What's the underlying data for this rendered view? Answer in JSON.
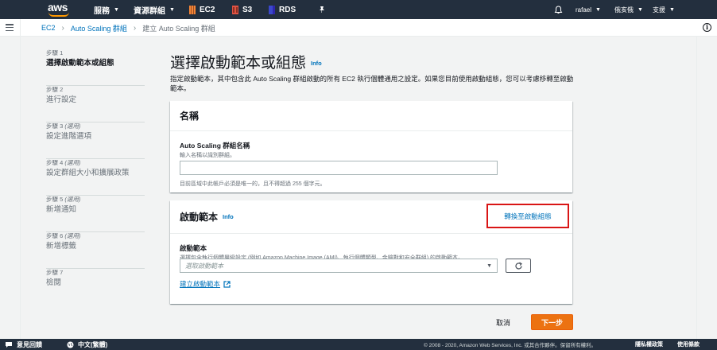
{
  "topnav": {
    "logo": "aws",
    "services": "服務",
    "resource_groups": "資源群組",
    "ec2": "EC2",
    "s3": "S3",
    "rds": "RDS",
    "user": "rafael",
    "region": "俄亥俄",
    "support": "支援",
    "colors": {
      "ec2": "#f58536",
      "s3": "#e05243",
      "rds": "#3b48cc",
      "bg": "#232f3e"
    }
  },
  "breadcrumb": {
    "items": [
      "EC2",
      "Auto Scaling 群組",
      "建立 Auto Scaling 群組"
    ]
  },
  "steps": [
    {
      "num": "步驟 1",
      "optional": "",
      "title": "選擇啟動範本或組態",
      "active": true
    },
    {
      "num": "步驟 2",
      "optional": "",
      "title": "進行設定",
      "active": false
    },
    {
      "num": "步驟 3",
      "optional": "(選用)",
      "title": "設定進階選項",
      "active": false
    },
    {
      "num": "步驟 4",
      "optional": "(選用)",
      "title": "設定群組大小和擴展政策",
      "active": false
    },
    {
      "num": "步驟 5",
      "optional": "(選用)",
      "title": "新增通知",
      "active": false
    },
    {
      "num": "步驟 6",
      "optional": "(選用)",
      "title": "新增標籤",
      "active": false
    },
    {
      "num": "步驟 7",
      "optional": "",
      "title": "檢閱",
      "active": false
    }
  ],
  "main": {
    "title": "選擇啟動範本或組態",
    "info": "Info",
    "description": "指定啟動範本，其中包含此 Auto Scaling 群組啟動的所有 EC2 執行個體通用之設定。如果您目前使用啟動組態，您可以考慮移轉至啟動範本。"
  },
  "name_panel": {
    "title": "名稱",
    "field_label": "Auto Scaling 群組名稱",
    "field_desc": "輸入名稱以識別群組。",
    "value": "",
    "hint": "目前區域中此帳戶必須是唯一的，且不得超過 255 個字元。"
  },
  "template_panel": {
    "title": "啟動範本",
    "info": "Info",
    "switch_link": "轉換至啟動組態",
    "field_label": "啟動範本",
    "field_desc": "選擇包含執行個體層級設定 (例如 Amazon Machine Image (AMI)、執行個體類型、金鑰對和安全群組) 的啟動範本。",
    "select_placeholder": "選取啟動範本",
    "create_link": "建立啟動範本"
  },
  "actions": {
    "cancel": "取消",
    "next": "下一步",
    "next_color": "#ec7211"
  },
  "footer": {
    "feedback": "意見回饋",
    "language": "中文(繁體)",
    "copyright": "© 2008 - 2020, Amazon Web Services, Inc. 或其合作夥伴。保留所有權利。",
    "privacy": "隱私權政策",
    "terms": "使用條款"
  }
}
